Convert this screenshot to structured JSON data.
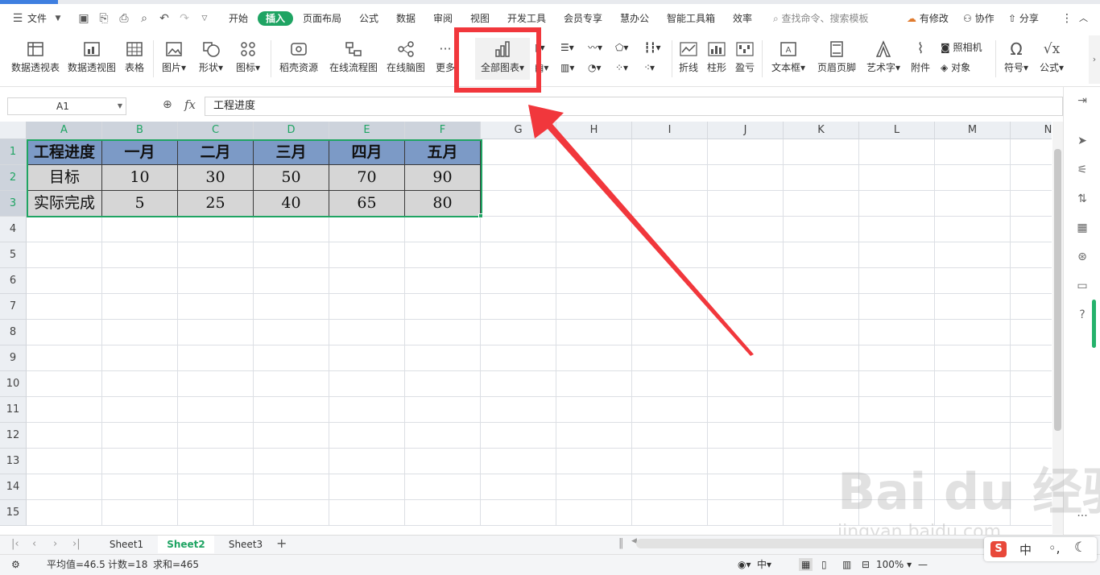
{
  "menu": {
    "file_label": "文件",
    "tabs": [
      "开始",
      "插入",
      "页面布局",
      "公式",
      "数据",
      "审阅",
      "视图",
      "开发工具",
      "会员专享",
      "慧办公",
      "智能工具箱",
      "效率"
    ],
    "active_tab": "插入",
    "search_placeholder": "查找命令、搜索模板",
    "changes_label": "有修改",
    "collab_label": "协作",
    "share_label": "分享"
  },
  "ribbon": {
    "pivot_table": "数据透视表",
    "pivot_chart": "数据透视图",
    "table": "表格",
    "picture": "图片",
    "shape": "形状",
    "icon": "图标",
    "daoke_resource": "稻壳资源",
    "online_flowchart": "在线流程图",
    "online_mindmap": "在线脑图",
    "more": "更多",
    "all_charts": "全部图表",
    "line": "折线",
    "column": "柱形",
    "winloss": "盈亏",
    "textbox": "文本框",
    "header_footer": "页眉页脚",
    "wordart": "艺术字",
    "attachment": "附件",
    "camera": "照相机",
    "object": "对象",
    "symbol": "符号",
    "formula": "公式"
  },
  "formula_bar": {
    "name_box": "A1",
    "fx_label": "fx",
    "value": "工程进度"
  },
  "grid": {
    "columns": [
      "A",
      "B",
      "C",
      "D",
      "E",
      "F",
      "G",
      "H",
      "I",
      "J",
      "K",
      "L",
      "M",
      "N"
    ],
    "rows": [
      "1",
      "2",
      "3",
      "4",
      "5",
      "6",
      "7",
      "8",
      "9",
      "10",
      "11",
      "12",
      "13",
      "14",
      "15"
    ],
    "table": [
      [
        "工程进度",
        "一月",
        "二月",
        "三月",
        "四月",
        "五月"
      ],
      [
        "目标",
        "10",
        "30",
        "50",
        "70",
        "90"
      ],
      [
        "实际完成",
        "5",
        "25",
        "40",
        "65",
        "80"
      ]
    ]
  },
  "sheets": [
    "Sheet1",
    "Sheet2",
    "Sheet3"
  ],
  "active_sheet": "Sheet2",
  "status": {
    "average": "平均值=46.5",
    "count": "计数=18",
    "sum": "求和=465",
    "zoom": "100%",
    "ime_lang": "中"
  },
  "watermark": {
    "brand": "Bai du 经验",
    "url": "jingyan.baidu.com"
  },
  "colors": {
    "accent": "#1fa463",
    "highlight_box": "#f1373c",
    "header_fill": "#7c9ac6",
    "body_fill": "#d6d6d6"
  }
}
